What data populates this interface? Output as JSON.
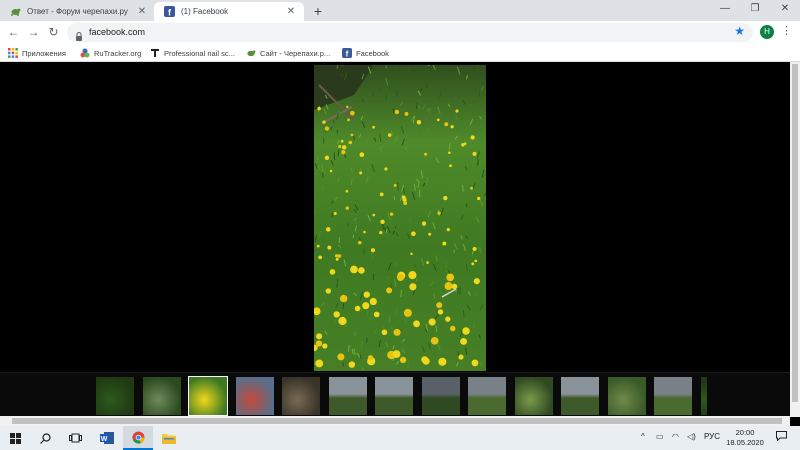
{
  "tabs": [
    {
      "title": "Ответ - Форум черепахи.ру",
      "active": false,
      "icon": "turtle-icon"
    },
    {
      "title": "(1) Facebook",
      "active": true,
      "icon": "facebook-icon"
    }
  ],
  "address": {
    "url": "facebook.com",
    "profile_initial": "H"
  },
  "bookmarks": [
    {
      "label": "Приложения",
      "icon": "apps-grid-icon"
    },
    {
      "label": "RuTracker.org",
      "icon": "rutracker-icon"
    },
    {
      "label": "Professional nail sc...",
      "icon": "nail-icon"
    },
    {
      "label": "Сайт - Черепахи.р...",
      "icon": "turtle-icon"
    },
    {
      "label": "Facebook",
      "icon": "facebook-icon"
    }
  ],
  "viewer": {
    "thumbnails": [
      {
        "kind": "grass-dark",
        "selected": false
      },
      {
        "kind": "grass-path",
        "selected": false
      },
      {
        "kind": "grass-dandelion",
        "selected": true
      },
      {
        "kind": "room-colorful",
        "selected": false
      },
      {
        "kind": "garden-rocks",
        "selected": false
      },
      {
        "kind": "field-sky",
        "selected": false
      },
      {
        "kind": "field-sky",
        "selected": false
      },
      {
        "kind": "field-sky-dark",
        "selected": false
      },
      {
        "kind": "field-flat",
        "selected": false
      },
      {
        "kind": "bush",
        "selected": false
      },
      {
        "kind": "field-sky",
        "selected": false
      },
      {
        "kind": "grass-tall",
        "selected": false
      },
      {
        "kind": "field-flat",
        "selected": false
      },
      {
        "kind": "grass-dark",
        "selected": false
      }
    ]
  },
  "taskbar": {
    "items": [
      "start-icon",
      "search-icon",
      "task-view-icon",
      "word-icon",
      "chrome-icon",
      "file-explorer-icon"
    ],
    "language": "РУС",
    "time": "20:00",
    "date": "18.05.2020"
  },
  "colors": {
    "accent": "#1a73e8",
    "taskbar_active": "#0078d7",
    "facebook": "#3b5998"
  }
}
